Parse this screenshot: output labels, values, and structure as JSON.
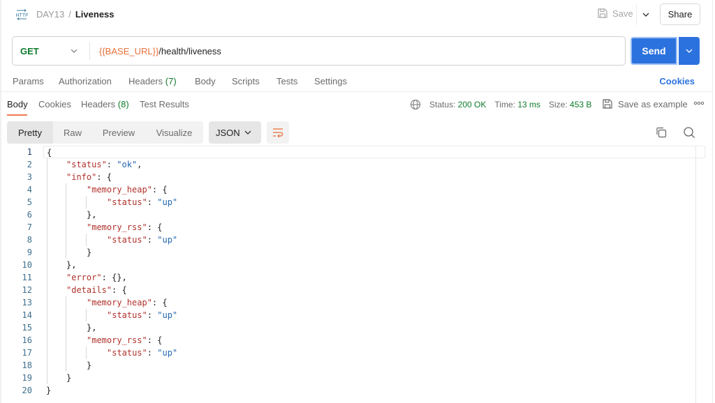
{
  "header": {
    "protocol_icon": "http-icon",
    "breadcrumb": {
      "parent": "DAY13",
      "separator": "/",
      "current": "Liveness"
    },
    "save_label": "Save",
    "share_label": "Share"
  },
  "request": {
    "method": "GET",
    "url_variable": "{{BASE_URL}}",
    "url_path": "/health/liveness",
    "send_label": "Send"
  },
  "request_tabs": {
    "items": [
      {
        "label": "Params",
        "count": null
      },
      {
        "label": "Authorization",
        "count": null
      },
      {
        "label": "Headers",
        "count": "(7)"
      },
      {
        "label": "Body",
        "count": null
      },
      {
        "label": "Scripts",
        "count": null
      },
      {
        "label": "Tests",
        "count": null
      },
      {
        "label": "Settings",
        "count": null
      }
    ],
    "cookies_label": "Cookies"
  },
  "response_tabs": {
    "items": [
      {
        "label": "Body",
        "count": null,
        "active": true
      },
      {
        "label": "Cookies",
        "count": null,
        "active": false
      },
      {
        "label": "Headers",
        "count": "(8)",
        "active": false
      },
      {
        "label": "Test Results",
        "count": null,
        "active": false
      }
    ]
  },
  "response_meta": {
    "status_label": "Status:",
    "status_value": "200 OK",
    "time_label": "Time:",
    "time_value": "13 ms",
    "size_label": "Size:",
    "size_value": "453 B",
    "save_example_label": "Save as example"
  },
  "view_modes": [
    "Pretty",
    "Raw",
    "Preview",
    "Visualize"
  ],
  "active_view_mode": "Pretty",
  "format": "JSON",
  "colors": {
    "accent": "#2c72de",
    "success": "#0f7b2e",
    "variable": "#e8703a",
    "tab_underline": "#ef7a4e",
    "json_key": "#b0312b",
    "json_string": "#2467b0"
  },
  "body_lines": [
    {
      "n": "1",
      "indent": 0,
      "parts": [
        [
          "p",
          "{"
        ]
      ]
    },
    {
      "n": "2",
      "indent": 1,
      "parts": [
        [
          "k",
          "\"status\""
        ],
        [
          "p",
          ": "
        ],
        [
          "s",
          "\"ok\""
        ],
        [
          "p",
          ","
        ]
      ]
    },
    {
      "n": "3",
      "indent": 1,
      "parts": [
        [
          "k",
          "\"info\""
        ],
        [
          "p",
          ": {"
        ]
      ]
    },
    {
      "n": "4",
      "indent": 2,
      "parts": [
        [
          "k",
          "\"memory_heap\""
        ],
        [
          "p",
          ": {"
        ]
      ]
    },
    {
      "n": "5",
      "indent": 3,
      "parts": [
        [
          "k",
          "\"status\""
        ],
        [
          "p",
          ": "
        ],
        [
          "s",
          "\"up\""
        ]
      ]
    },
    {
      "n": "6",
      "indent": 2,
      "parts": [
        [
          "p",
          "},"
        ]
      ]
    },
    {
      "n": "7",
      "indent": 2,
      "parts": [
        [
          "k",
          "\"memory_rss\""
        ],
        [
          "p",
          ": {"
        ]
      ]
    },
    {
      "n": "8",
      "indent": 3,
      "parts": [
        [
          "k",
          "\"status\""
        ],
        [
          "p",
          ": "
        ],
        [
          "s",
          "\"up\""
        ]
      ]
    },
    {
      "n": "9",
      "indent": 2,
      "parts": [
        [
          "p",
          "}"
        ]
      ]
    },
    {
      "n": "10",
      "indent": 1,
      "parts": [
        [
          "p",
          "},"
        ]
      ]
    },
    {
      "n": "11",
      "indent": 1,
      "parts": [
        [
          "k",
          "\"error\""
        ],
        [
          "p",
          ": {},"
        ]
      ]
    },
    {
      "n": "12",
      "indent": 1,
      "parts": [
        [
          "k",
          "\"details\""
        ],
        [
          "p",
          ": {"
        ]
      ]
    },
    {
      "n": "13",
      "indent": 2,
      "parts": [
        [
          "k",
          "\"memory_heap\""
        ],
        [
          "p",
          ": {"
        ]
      ]
    },
    {
      "n": "14",
      "indent": 3,
      "parts": [
        [
          "k",
          "\"status\""
        ],
        [
          "p",
          ": "
        ],
        [
          "s",
          "\"up\""
        ]
      ]
    },
    {
      "n": "15",
      "indent": 2,
      "parts": [
        [
          "p",
          "},"
        ]
      ]
    },
    {
      "n": "16",
      "indent": 2,
      "parts": [
        [
          "k",
          "\"memory_rss\""
        ],
        [
          "p",
          ": {"
        ]
      ]
    },
    {
      "n": "17",
      "indent": 3,
      "parts": [
        [
          "k",
          "\"status\""
        ],
        [
          "p",
          ": "
        ],
        [
          "s",
          "\"up\""
        ]
      ]
    },
    {
      "n": "18",
      "indent": 2,
      "parts": [
        [
          "p",
          "}"
        ]
      ]
    },
    {
      "n": "19",
      "indent": 1,
      "parts": [
        [
          "p",
          "}"
        ]
      ]
    },
    {
      "n": "20",
      "indent": 0,
      "parts": [
        [
          "p",
          "}"
        ]
      ]
    }
  ]
}
